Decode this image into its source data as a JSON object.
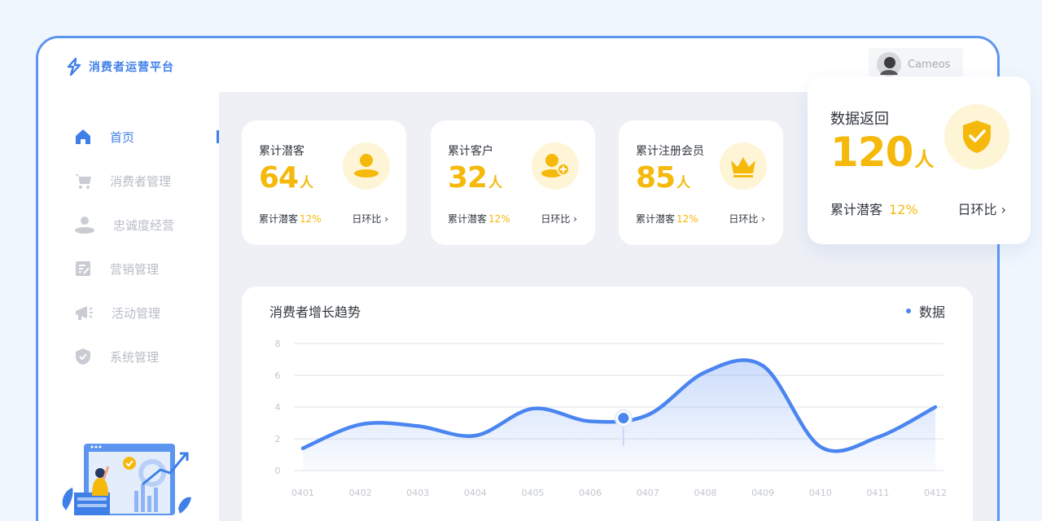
{
  "app": {
    "title": "消费者运营平台"
  },
  "sidebar": {
    "items": [
      {
        "label": "首页",
        "icon": "home-icon",
        "active": true
      },
      {
        "label": "消费者管理",
        "icon": "cart-icon"
      },
      {
        "label": "忠诚度经营",
        "icon": "user-icon"
      },
      {
        "label": "营销管理",
        "icon": "edit-document-icon"
      },
      {
        "label": "活动管理",
        "icon": "megaphone-icon"
      },
      {
        "label": "系统管理",
        "icon": "shield-icon"
      }
    ]
  },
  "header": {
    "user_name": "Cameos"
  },
  "cards": [
    {
      "title": "累计潜客",
      "value": "64",
      "unit": "人",
      "foot_label": "累计潜客",
      "foot_pct": "12%",
      "compare": "日环比 ›",
      "icon": "user-icon"
    },
    {
      "title": "累计客户",
      "value": "32",
      "unit": "人",
      "foot_label": "累计潜客",
      "foot_pct": "12%",
      "compare": "日环比 ›",
      "icon": "add-user-icon"
    },
    {
      "title": "累计注册会员",
      "value": "85",
      "unit": "人",
      "foot_label": "累计潜客",
      "foot_pct": "12%",
      "compare": "日环比 ›",
      "icon": "crown-icon"
    }
  ],
  "highlight": {
    "title": "数据返回",
    "value": "120",
    "unit": "人",
    "foot_label": "累计潜客",
    "foot_pct": "12%",
    "compare": "日环比 ›",
    "icon": "shield-check-icon"
  },
  "chart": {
    "title": "消费者增长趋势",
    "legend": "数据"
  },
  "chart_data": {
    "type": "area",
    "x": [
      "0401",
      "0402",
      "0403",
      "0404",
      "0405",
      "0406",
      "0407",
      "0408",
      "0409",
      "0410",
      "0411",
      "0412"
    ],
    "series": [
      {
        "name": "数据",
        "values": [
          1.4,
          2.9,
          2.8,
          2.2,
          3.9,
          3.1,
          3.5,
          6.2,
          6.6,
          1.5,
          2.1,
          4.0
        ]
      }
    ],
    "highlighted_x": "0407",
    "ylim": [
      0,
      8
    ],
    "yticks": [
      "0",
      "2",
      "4",
      "6",
      "8"
    ],
    "grid": true,
    "colors": {
      "line": "#4a85f0",
      "accent": "#f5b90c"
    }
  }
}
